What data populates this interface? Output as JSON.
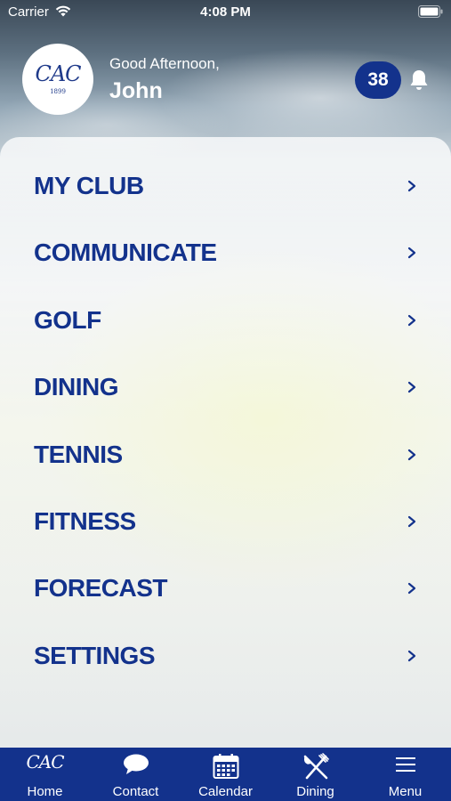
{
  "colors": {
    "brand_blue": "#13328c",
    "white": "#ffffff"
  },
  "status_bar": {
    "carrier": "Carrier",
    "time": "4:08 PM",
    "icons": [
      "wifi-icon",
      "battery-icon"
    ]
  },
  "header": {
    "logo": {
      "mark": "CAC",
      "year": "1899"
    },
    "greeting": "Good Afternoon,",
    "user_name": "John",
    "notification_count": "38",
    "bell_icon": "bell-icon"
  },
  "menu": {
    "items": [
      {
        "label": "MY CLUB"
      },
      {
        "label": "COMMUNICATE"
      },
      {
        "label": "GOLF"
      },
      {
        "label": "DINING"
      },
      {
        "label": "TENNIS"
      },
      {
        "label": "FITNESS"
      },
      {
        "label": "FORECAST"
      },
      {
        "label": "SETTINGS"
      }
    ],
    "chevron_icon": "chevron-right-icon"
  },
  "tab_bar": {
    "tabs": [
      {
        "label": "Home",
        "icon": "club-logo-icon"
      },
      {
        "label": "Contact",
        "icon": "chat-bubble-icon"
      },
      {
        "label": "Calendar",
        "icon": "calendar-icon"
      },
      {
        "label": "Dining",
        "icon": "fork-knife-icon"
      },
      {
        "label": "Menu",
        "icon": "hamburger-icon"
      }
    ]
  }
}
